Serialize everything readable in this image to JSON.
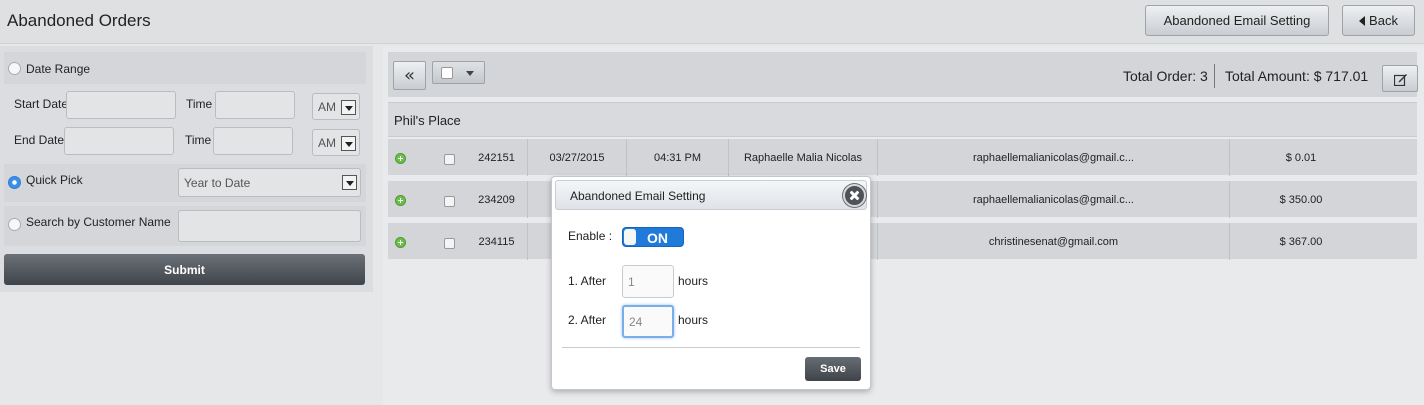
{
  "header": {
    "title": "Abandoned Orders",
    "email_setting_label": "Abandoned Email Setting",
    "back_label": "Back"
  },
  "filters": {
    "date_range_label": "Date Range",
    "start_date_label": "Start Date",
    "start_date_value": "",
    "start_time_label": "Time",
    "start_time_value": "",
    "start_ampm": "AM",
    "end_date_label": "End Date",
    "end_date_value": "",
    "end_time_label": "Time",
    "end_time_value": "",
    "end_ampm": "AM",
    "quick_pick_label": "Quick Pick",
    "quick_pick_value": "Year to Date",
    "quick_pick_selected": true,
    "search_customer_label": "Search by Customer Name",
    "search_customer_value": "",
    "submit_label": "Submit"
  },
  "summary": {
    "total_order": "Total Order: 3",
    "total_amount": "Total Amount: $ 717.01"
  },
  "store": {
    "name": "Phil's Place"
  },
  "orders": [
    {
      "id": "242151",
      "date": "03/27/2015",
      "time": "04:31 PM",
      "customer": "Raphaelle Malia Nicolas",
      "email": "raphaellemalianicolas@gmail.c...",
      "amount": "$ 0.01"
    },
    {
      "id": "234209",
      "date": "",
      "time": "",
      "customer": "",
      "email": "raphaellemalianicolas@gmail.c...",
      "amount": "$ 350.00"
    },
    {
      "id": "234115",
      "date": "",
      "time": "",
      "customer": "",
      "email": "christinesenat@gmail.com",
      "amount": "$ 367.00"
    }
  ],
  "modal": {
    "title": "Abandoned Email Setting",
    "enable_label": "Enable :",
    "toggle_text": "ON",
    "after1_label": "1. After",
    "after1_value": "1",
    "after2_label": "2. After",
    "after2_value": "24",
    "hours_label": "hours",
    "save_label": "Save"
  },
  "colors": {
    "accent": "#1f7ad9",
    "dark_button": "#40454b",
    "row_bg": "#d3d5d8"
  }
}
